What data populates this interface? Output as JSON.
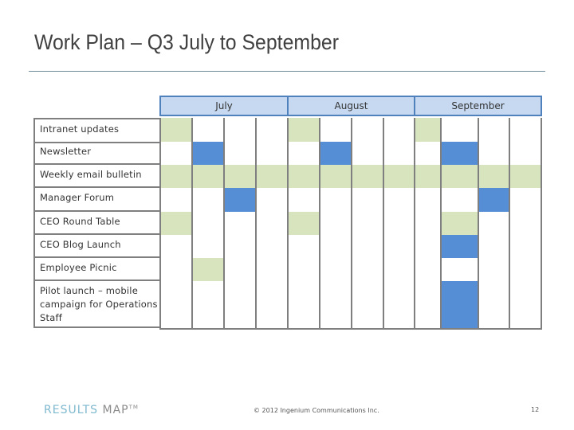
{
  "slide": {
    "title": "Work Plan – Q3 July to September"
  },
  "colors": {
    "header_fill": "#c6d9f1",
    "header_border": "#4f81bd",
    "grid_line": "#7f7f7f",
    "green": "#d7e4bd",
    "blue": "#558ed5"
  },
  "months": [
    {
      "label": "July",
      "weeks": 4
    },
    {
      "label": "August",
      "weeks": 4
    },
    {
      "label": "September",
      "weeks": 4
    }
  ],
  "rows": [
    {
      "label": "Intranet updates",
      "cells": [
        "green",
        "",
        "",
        "",
        "green",
        "",
        "",
        "",
        "green",
        "",
        "",
        ""
      ]
    },
    {
      "label": "Newsletter",
      "cells": [
        "",
        "blue",
        "",
        "",
        "",
        "blue",
        "",
        "",
        "",
        "blue",
        "",
        ""
      ]
    },
    {
      "label": "Weekly email bulletin",
      "cells": [
        "green",
        "green",
        "green",
        "green",
        "green",
        "green",
        "green",
        "green",
        "green",
        "green",
        "green",
        "green"
      ]
    },
    {
      "label": "Manager Forum",
      "cells": [
        "",
        "",
        "blue",
        "",
        "",
        "",
        "",
        "",
        "",
        "",
        "blue",
        ""
      ]
    },
    {
      "label": "CEO Round Table",
      "cells": [
        "green",
        "",
        "",
        "",
        "green",
        "",
        "",
        "",
        "",
        "green",
        "",
        ""
      ]
    },
    {
      "label": "CEO Blog Launch",
      "cells": [
        "",
        "",
        "",
        "",
        "",
        "",
        "",
        "",
        "",
        "blue",
        "",
        ""
      ]
    },
    {
      "label": "Employee Picnic",
      "cells": [
        "",
        "green",
        "",
        "",
        "",
        "",
        "",
        "",
        "",
        "",
        "",
        ""
      ]
    },
    {
      "label": "Pilot launch – mobile campaign for Operations Staff",
      "cells": [
        "",
        "",
        "",
        "",
        "",
        "",
        "",
        "",
        "",
        "blue",
        "",
        ""
      ]
    }
  ],
  "footer": {
    "logo_part1": "RESULTS",
    "logo_part2": "MAP",
    "logo_tm": "TM",
    "copyright": "© 2012 Ingenium Communications Inc.",
    "page_number": "12"
  }
}
